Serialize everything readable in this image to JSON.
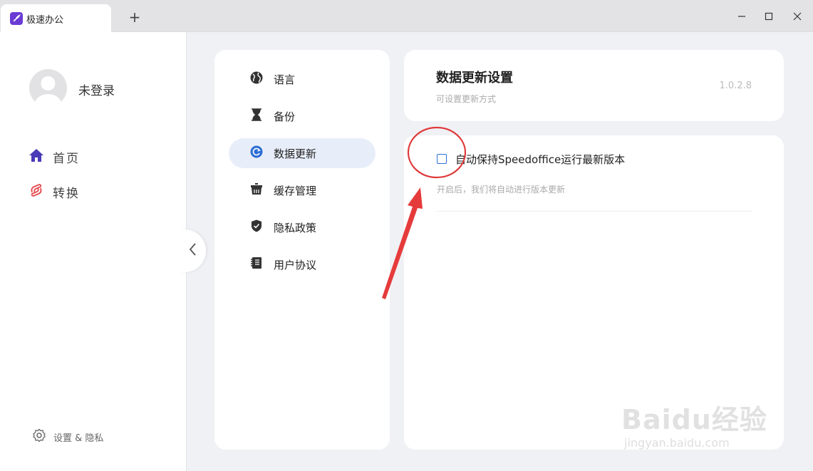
{
  "window": {
    "tab_title": "极速办公",
    "new_tab_symbol": "+",
    "accent": "#6a3bd4"
  },
  "user": {
    "name": "未登录"
  },
  "nav": {
    "items": [
      {
        "label": "首页",
        "icon": "home-icon",
        "color": "#4a3ab8"
      },
      {
        "label": "转换",
        "icon": "convert-icon",
        "color": "#e5484d"
      }
    ],
    "settings_label": "设置 & 隐私"
  },
  "menu": {
    "items": [
      {
        "label": "语言",
        "icon": "globe-icon"
      },
      {
        "label": "备份",
        "icon": "hourglass-icon"
      },
      {
        "label": "数据更新",
        "icon": "refresh-icon",
        "active": true
      },
      {
        "label": "缓存管理",
        "icon": "cache-icon"
      },
      {
        "label": "隐私政策",
        "icon": "shield-icon"
      },
      {
        "label": "用户协议",
        "icon": "notebook-icon"
      }
    ],
    "active_color": "#2d6fd6"
  },
  "header": {
    "title": "数据更新设置",
    "subtitle": "可设置更新方式",
    "version": "1.0.2.8"
  },
  "content": {
    "checkbox_label": "自动保持Speedoffice运行最新版本",
    "checkbox_checked": false,
    "description": "开启后，我们将自动进行版本更新"
  },
  "watermark": {
    "brand": "Baidu经验",
    "url": "jingyan.baidu.com"
  }
}
